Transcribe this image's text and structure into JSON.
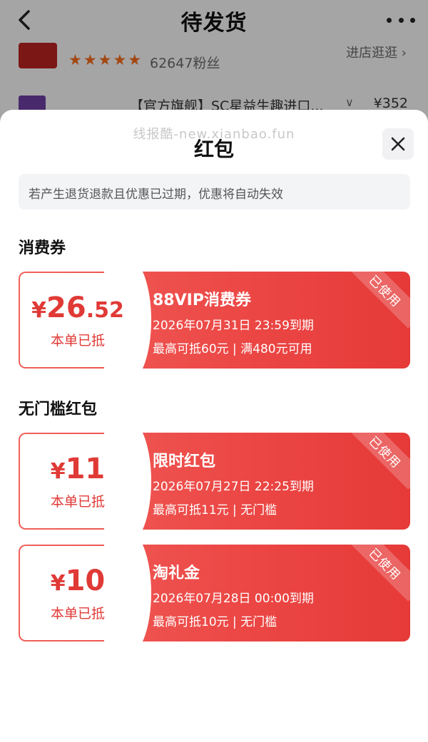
{
  "header": {
    "title": "待发货",
    "back_icon": "chevron-left-icon",
    "more_icon": "more-dots-icon"
  },
  "shop": {
    "stars": [
      "★",
      "★",
      "★",
      "★",
      "★"
    ],
    "fans": "62647粉丝",
    "visit_label": "进店逛逛 ›"
  },
  "product": {
    "name": "【官方旗舰】SC星益生趣进口...",
    "chevron": "∨",
    "price": "¥352"
  },
  "sheet": {
    "watermark": "线报酷-new.xianbao.fun",
    "title": "红包",
    "close_icon": "close-icon",
    "notice": "若产生退货退款且优惠已过期，优惠将自动失效"
  },
  "sections": {
    "consumption_title": "消费券",
    "redpacket_title": "无门槛红包"
  },
  "coupons": [
    {
      "amount_yen": "¥",
      "amount_int": "26",
      "amount_dec": ".52",
      "deducted": "本单已抵",
      "name": "88VIP消费券",
      "expiry": "2026年07月31日  23:59到期",
      "rule": "最高可抵60元 | 满480元可用",
      "stamp": "已使用"
    },
    {
      "amount_yen": "¥",
      "amount_int": "11",
      "amount_dec": "",
      "deducted": "本单已抵",
      "name": "限时红包",
      "expiry": "2026年07月27日  22:25到期",
      "rule": "最高可抵11元 | 无门槛",
      "stamp": "已使用"
    },
    {
      "amount_yen": "¥",
      "amount_int": "10",
      "amount_dec": "",
      "deducted": "本单已抵",
      "name": "淘礼金",
      "expiry": "2026年07月28日  00:00到期",
      "rule": "最高可抵10元 | 无门槛",
      "stamp": "已使用"
    }
  ],
  "colors": {
    "coupon_red": "#ec4846",
    "amount_red": "#e03a36",
    "star_orange": "#f06b1d"
  }
}
